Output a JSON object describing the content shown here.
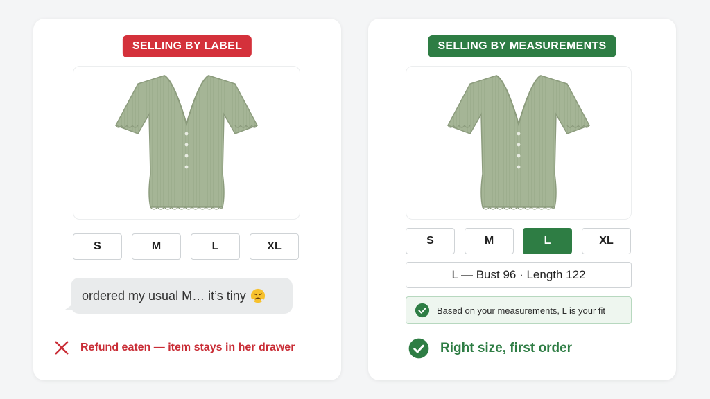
{
  "left_card": {
    "badge": "SELLING BY LABEL",
    "sizes": [
      "S",
      "M",
      "L",
      "XL"
    ],
    "chat_message": "ordered my usual M… it’s tiny",
    "emoji_icon": "frustrated-face-emoji",
    "outcome": "Refund eaten — item stays in her drawer",
    "outcome_icon": "x-icon"
  },
  "right_card": {
    "badge": "SELLING BY MEASUREMENTS",
    "sizes": [
      "S",
      "M",
      "L",
      "XL"
    ],
    "selected_size": "L",
    "measurements": "L — Bust 96 · Length 122",
    "fit_note": "Based on your measurements, L is your fit",
    "outcome": "Right size, first order",
    "outcome_icon": "check-circle-icon"
  },
  "colors": {
    "red": "#d4313b",
    "green": "#2e7d44",
    "shirt": "#a5b596"
  }
}
